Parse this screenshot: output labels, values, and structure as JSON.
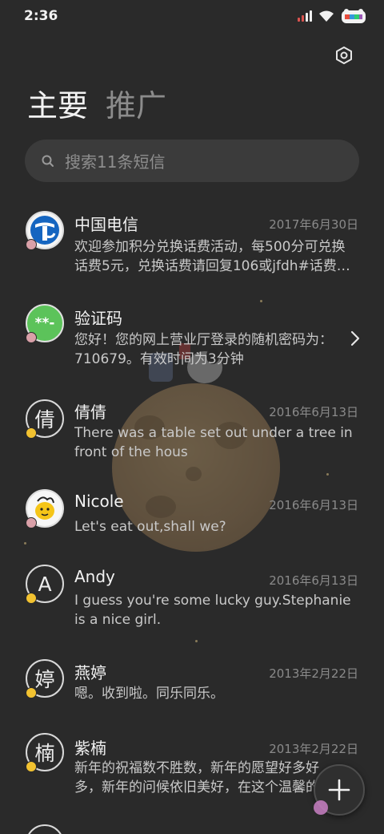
{
  "status_bar": {
    "time": "2:36"
  },
  "tabs": [
    {
      "label": "主要"
    },
    {
      "label": "推广"
    }
  ],
  "search": {
    "placeholder": "搜索11条短信"
  },
  "messages": [
    {
      "name": "中国电信",
      "date": "2017年6月30日",
      "preview": "欢迎参加积分兑换话费活动，每500分可兑换话费5元，兑换话费请回复106或jfdh#话费…",
      "avatar": "china-telecom-logo"
    },
    {
      "name": "验证码",
      "date": "",
      "preview": "您好！您的网上营业厅登录的随机密码为：710679。有效时间为3分钟",
      "avatar": "password-icon",
      "avatar_text": "**-"
    },
    {
      "name": "倩倩",
      "date": "2016年6月13日",
      "preview": "There was a table set out under a tree in front of the hous",
      "avatar_letter": "倩"
    },
    {
      "name": "Nicole",
      "date": "2016年6月13日",
      "preview": "Let's eat out,shall we?",
      "avatar": "woodstock-avatar"
    },
    {
      "name": "Andy",
      "date": "2016年6月13日",
      "preview": "I guess you're some lucky guy.Stephanie is a nice girl.",
      "avatar_letter": "A"
    },
    {
      "name": "燕婷",
      "date": "2013年2月22日",
      "preview": "嗯。收到啦。同乐同乐。",
      "avatar_letter": "婷"
    },
    {
      "name": "紫楠",
      "date": "2013年2月22日",
      "preview": "新年的祝福数不胜数，新年的愿望好多好多，新年的问候依旧美好，在这个温馨的时",
      "avatar_letter": "楠"
    }
  ],
  "colors": {
    "background": "#2a2a2a",
    "search_bg": "#3b3b3b",
    "telecom_blue": "#1565c0",
    "code_green": "#5cc35a"
  }
}
